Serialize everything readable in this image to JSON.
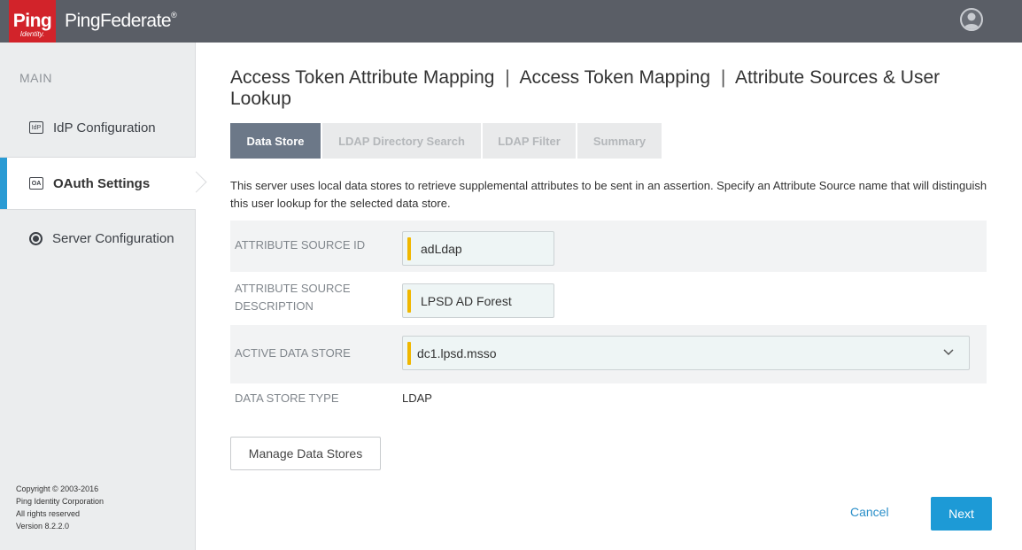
{
  "header": {
    "logo_text": "Ping",
    "logo_subtext": "Identity.",
    "product_name": "PingFederate",
    "product_reg": "®",
    "user_icon": "user-avatar-icon"
  },
  "sidebar": {
    "heading": "MAIN",
    "items": [
      {
        "label": "IdP Configuration",
        "icon": "idp-icon",
        "icon_text": "IdP"
      },
      {
        "label": "OAuth Settings",
        "icon": "oauth-icon",
        "icon_text": "OA"
      },
      {
        "label": "Server Configuration",
        "icon": "server-icon",
        "icon_text": ""
      }
    ],
    "copyright": [
      "Copyright © 2003-2016",
      "Ping Identity Corporation",
      "All rights reserved",
      "Version 8.2.2.0"
    ]
  },
  "breadcrumb": {
    "parts": [
      "Access Token Attribute Mapping",
      "Access Token Mapping",
      "Attribute Sources & User Lookup"
    ],
    "separator": "|"
  },
  "tabs": [
    {
      "label": "Data Store",
      "active": true
    },
    {
      "label": "LDAP Directory Search",
      "active": false
    },
    {
      "label": "LDAP Filter",
      "active": false
    },
    {
      "label": "Summary",
      "active": false
    }
  ],
  "intro": "This server uses local data stores to retrieve supplemental attributes to be sent in an assertion. Specify an Attribute Source name that will distinguish this user lookup for the selected data store.",
  "form": {
    "source_id_label": "ATTRIBUTE SOURCE ID",
    "source_id_value": "adLdap",
    "description_label_1": "ATTRIBUTE SOURCE",
    "description_label_2": "DESCRIPTION",
    "description_value": "LPSD AD Forest",
    "data_store_label": "ACTIVE DATA STORE",
    "data_store_value": "dc1.lpsd.msso",
    "store_type_label": "DATA STORE TYPE",
    "store_type_value": "LDAP"
  },
  "buttons": {
    "manage": "Manage Data Stores",
    "cancel": "Cancel",
    "next": "Next"
  },
  "colors": {
    "brand_red": "#d2232a",
    "accent_blue": "#1d9ad6",
    "active_tab": "#6c7888",
    "required_marker": "#f0b700"
  }
}
